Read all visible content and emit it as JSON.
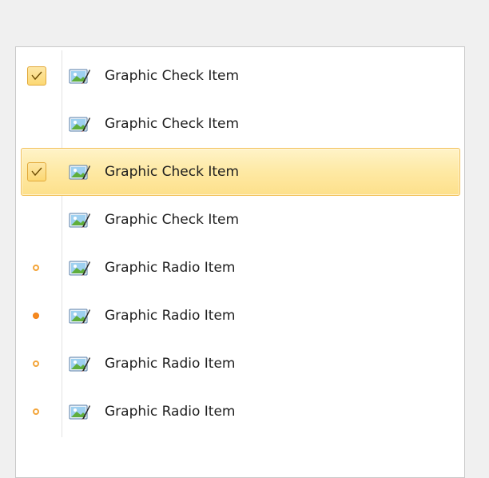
{
  "menu": {
    "items": [
      {
        "label": "Graphic Check Item",
        "kind": "check",
        "checked": true,
        "hovered": false,
        "icon": "picture-icon"
      },
      {
        "label": "Graphic Check Item",
        "kind": "check",
        "checked": false,
        "hovered": false,
        "icon": "picture-icon"
      },
      {
        "label": "Graphic Check Item",
        "kind": "check",
        "checked": true,
        "hovered": true,
        "icon": "picture-icon"
      },
      {
        "label": "Graphic Check Item",
        "kind": "check",
        "checked": false,
        "hovered": false,
        "icon": "picture-icon"
      },
      {
        "label": "Graphic Radio Item",
        "kind": "radio",
        "checked": false,
        "hovered": false,
        "icon": "picture-icon"
      },
      {
        "label": "Graphic Radio Item",
        "kind": "radio",
        "checked": true,
        "hovered": false,
        "icon": "picture-icon"
      },
      {
        "label": "Graphic Radio Item",
        "kind": "radio",
        "checked": false,
        "hovered": false,
        "icon": "picture-icon"
      },
      {
        "label": "Graphic Radio Item",
        "kind": "radio",
        "checked": false,
        "hovered": false,
        "icon": "picture-icon"
      }
    ]
  },
  "colors": {
    "hover_border": "#f2c056",
    "hover_fill": "#fee9a4",
    "check_fill": "#fcd873",
    "radio_accent": "#f58a1f",
    "gutter_line": "#e3e3e3"
  }
}
